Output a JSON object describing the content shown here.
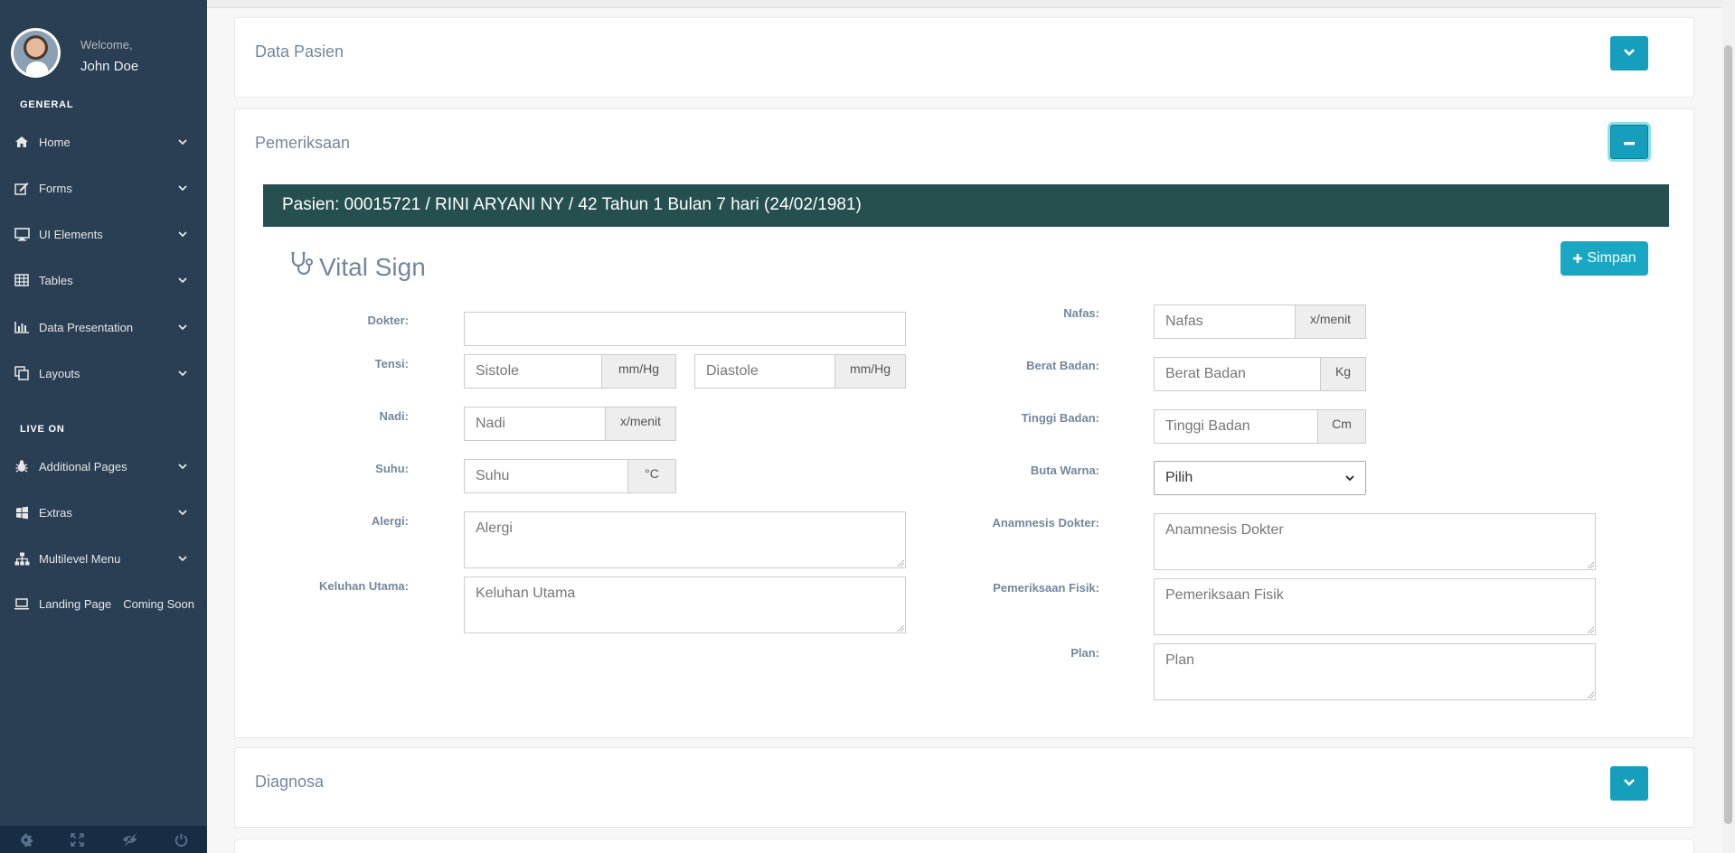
{
  "sidebar": {
    "welcome": "Welcome,",
    "username": "John Doe",
    "section_general": "GENERAL",
    "section_live": "LIVE ON",
    "general_items": [
      {
        "label": "Home",
        "icon": "home-icon"
      },
      {
        "label": "Forms",
        "icon": "edit-icon"
      },
      {
        "label": "UI Elements",
        "icon": "desktop-icon"
      },
      {
        "label": "Tables",
        "icon": "table-icon"
      },
      {
        "label": "Data Presentation",
        "icon": "bar-chart-icon"
      },
      {
        "label": "Layouts",
        "icon": "clone-icon"
      }
    ],
    "live_items": [
      {
        "label": "Additional Pages",
        "icon": "bug-icon"
      },
      {
        "label": "Extras",
        "icon": "windows-icon"
      },
      {
        "label": "Multilevel Menu",
        "icon": "sitemap-icon"
      },
      {
        "label": "Landing Page",
        "icon": "laptop-icon",
        "extra": "Coming Soon"
      }
    ],
    "footer_icons": [
      "settings-icon",
      "fullscreen-icon",
      "lock-icon",
      "logout-icon"
    ]
  },
  "panels": {
    "data_pasien": "Data Pasien",
    "pemeriksaan": "Pemeriksaan",
    "diagnosa": "Diagnosa"
  },
  "patient": {
    "banner": "Pasien: 00015721 / RINI ARYANI NY / 42 Tahun 1 Bulan 7 hari (24/02/1981)"
  },
  "vital_sign": {
    "title": "Vital Sign",
    "save_label": "Simpan"
  },
  "form": {
    "dokter_label": "Dokter:",
    "dokter_value": "",
    "tensi_label": "Tensi:",
    "sistole_placeholder": "Sistole",
    "sistole_unit": "mm/Hg",
    "diastole_placeholder": "Diastole",
    "diastole_unit": "mm/Hg",
    "nadi_label": "Nadi:",
    "nadi_placeholder": "Nadi",
    "nadi_unit": "x/menit",
    "suhu_label": "Suhu:",
    "suhu_placeholder": "Suhu",
    "suhu_unit": "°C",
    "alergi_label": "Alergi:",
    "alergi_placeholder": "Alergi",
    "keluhan_label": "Keluhan Utama:",
    "keluhan_placeholder": "Keluhan Utama",
    "nafas_label": "Nafas:",
    "nafas_placeholder": "Nafas",
    "nafas_unit": "x/menit",
    "berat_label": "Berat Badan:",
    "berat_placeholder": "Berat Badan",
    "berat_unit": "Kg",
    "tinggi_label": "Tinggi Badan:",
    "tinggi_placeholder": "Tinggi Badan",
    "tinggi_unit": "Cm",
    "buta_label": "Buta Warna:",
    "buta_value": "Pilih",
    "anamnesis_label": "Anamnesis Dokter:",
    "anamnesis_placeholder": "Anamnesis Dokter",
    "fisik_label": "Pemeriksaan Fisik:",
    "fisik_placeholder": "Pemeriksaan Fisik",
    "plan_label": "Plan:",
    "plan_placeholder": "Plan"
  },
  "colors": {
    "sidebar_bg": "#2a3f54",
    "accent": "#169fbd",
    "patient_bar": "#265050"
  }
}
